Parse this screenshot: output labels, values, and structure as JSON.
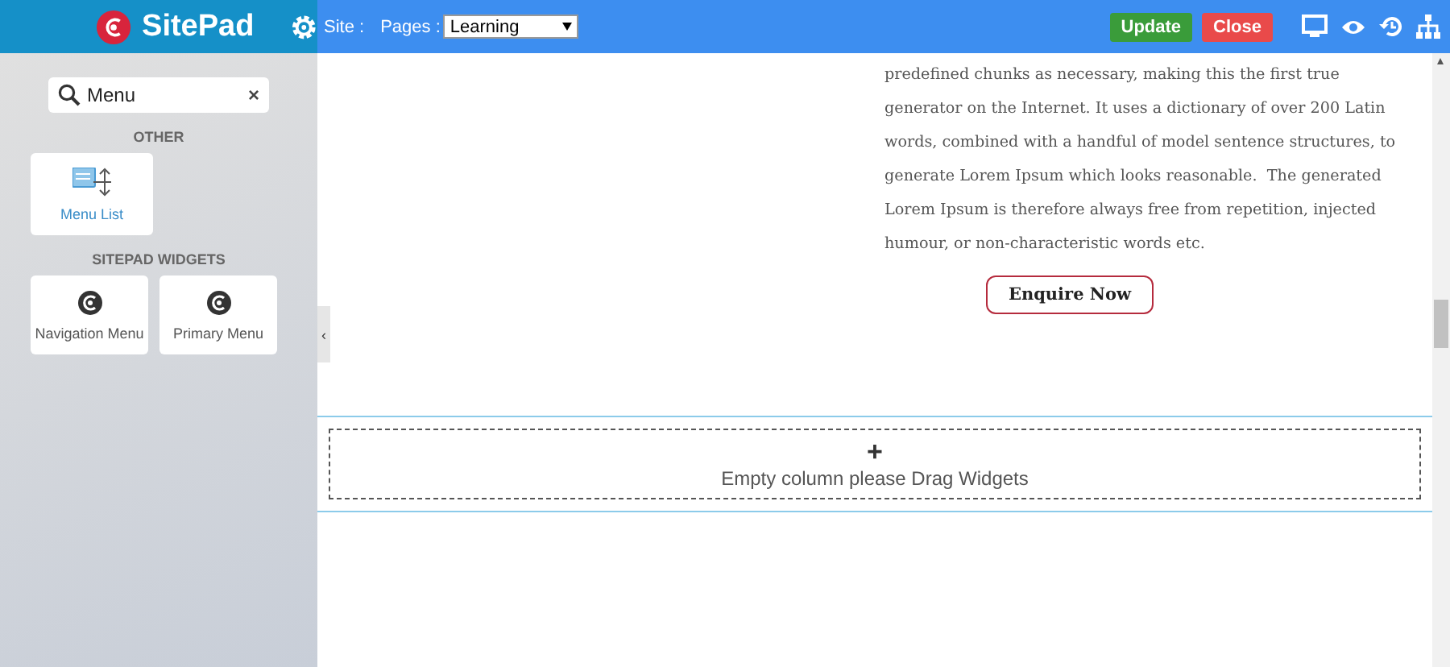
{
  "header": {
    "brand": "SitePad",
    "site_label": "Site :",
    "pages_label": "Pages :",
    "page_select": "Learning",
    "buttons": [
      {
        "label": "Update",
        "kind": "update"
      },
      {
        "label": "Close",
        "kind": "close"
      }
    ]
  },
  "sidebar": {
    "search": {
      "value": "Menu",
      "clear": "×"
    },
    "sections": [
      {
        "title": "OTHER",
        "widgets": [
          {
            "label": "Menu List",
            "kind": "menu-list"
          }
        ]
      },
      {
        "title": "SITEPAD WIDGETS",
        "widgets": [
          {
            "label": "Navigation Menu",
            "kind": "sitepad"
          },
          {
            "label": "Primary Menu",
            "kind": "sitepad"
          }
        ]
      }
    ],
    "collapse": "‹"
  },
  "content": {
    "paragraph_lines": [
      "predefined chunks as necessary, making this the first true",
      "generator on the Internet. It uses a dictionary of over 200 Latin",
      "words, combined with a handful of model sentence structures, to",
      "generate Lorem Ipsum which looks reasonable.  The generated",
      "Lorem Ipsum is therefore always free from repetition, injected",
      "humour, or non-characteristic words etc."
    ],
    "cta": "Enquire Now",
    "empty_column": {
      "plus": "+",
      "text": "Empty column please Drag Widgets"
    }
  }
}
